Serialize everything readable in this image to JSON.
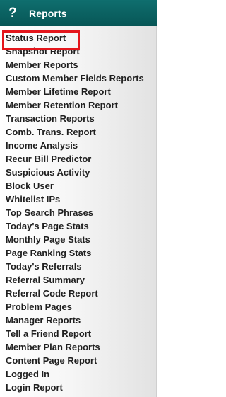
{
  "header": {
    "icon": "question-mark-icon",
    "icon_glyph": "?",
    "title": "Reports",
    "color": "#0a5f5f"
  },
  "highlight_color": "#e4161c",
  "menu": {
    "items": [
      "Status Report",
      "Snapshot Report",
      "Member Reports",
      "Custom Member Fields Reports",
      "Member Lifetime Report",
      "Member Retention Report",
      "Transaction Reports",
      "Comb. Trans. Report",
      "Income Analysis",
      "Recur Bill Predictor",
      "Suspicious Activity",
      "Block User",
      "Whitelist IPs",
      "Top Search Phrases",
      "Today's Page Stats",
      "Monthly Page Stats",
      "Page Ranking Stats",
      "Today's Referrals",
      "Referral Summary",
      "Referral Code Report",
      "Problem Pages",
      "Manager Reports",
      "Tell a Friend Report",
      "Member Plan Reports",
      "Content Page Report",
      "Logged In",
      "Login Report"
    ]
  }
}
